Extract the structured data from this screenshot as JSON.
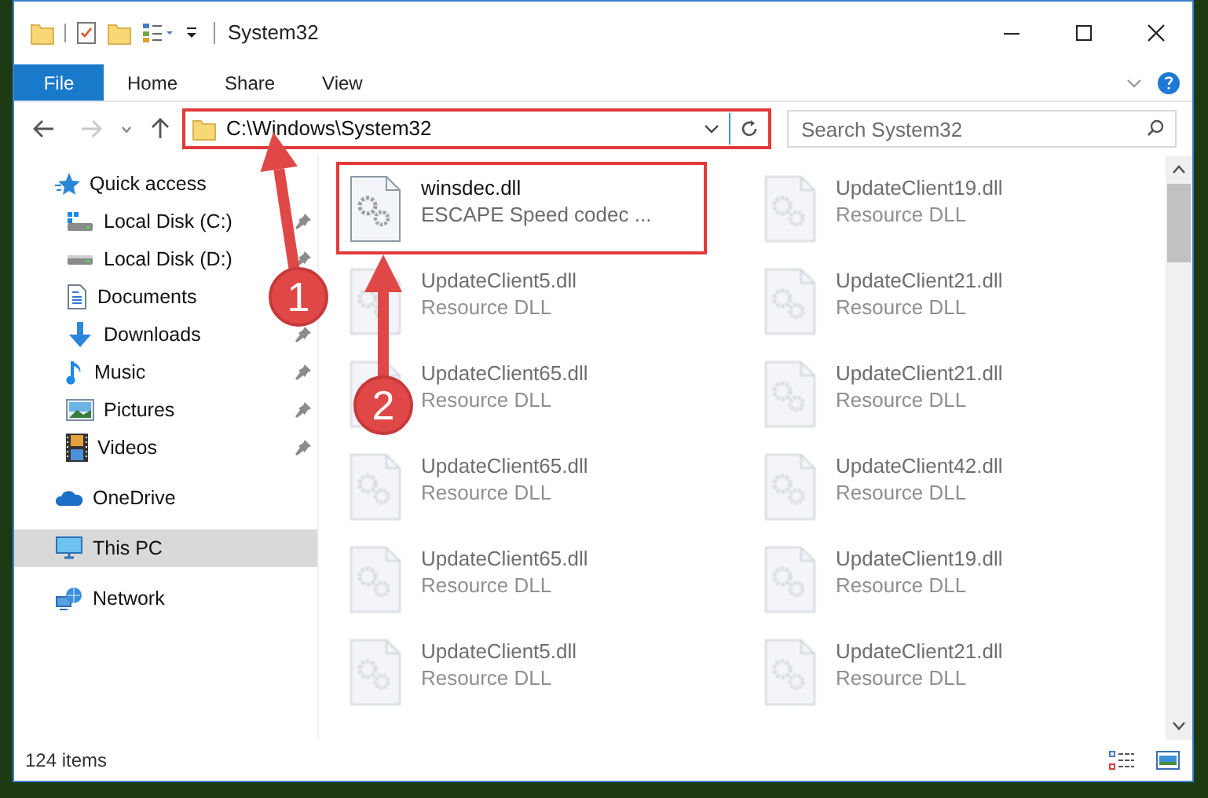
{
  "window": {
    "title": "System32"
  },
  "ribbon_tabs": [
    {
      "label": "File",
      "kind": "menu"
    },
    {
      "label": "Home",
      "kind": "tab"
    },
    {
      "label": "Share",
      "kind": "tab"
    },
    {
      "label": "View",
      "kind": "tab"
    }
  ],
  "address": {
    "path": "C:\\Windows\\System32",
    "highlighted": true
  },
  "search": {
    "placeholder": "Search System32"
  },
  "sidebar": {
    "items": [
      {
        "label": "Quick access",
        "selected": false,
        "children": [
          {
            "label": "Local Disk (C:)",
            "pinned": true,
            "selected": false
          },
          {
            "label": "Local Disk (D:)",
            "pinned": true,
            "selected": false
          },
          {
            "label": "Documents",
            "selected": false
          },
          {
            "label": "Downloads",
            "pinned": true,
            "selected": false
          },
          {
            "label": "Music",
            "pinned": true,
            "selected": false
          },
          {
            "label": "Pictures",
            "pinned": true,
            "selected": false
          },
          {
            "label": "Videos",
            "pinned": true,
            "selected": false
          }
        ]
      },
      {
        "label": "OneDrive",
        "selected": false
      },
      {
        "label": "This PC",
        "selected": true
      },
      {
        "label": "Network",
        "selected": false
      }
    ]
  },
  "files": [
    {
      "name": "winsdec.dll",
      "description": "ESCAPE Speed codec ...",
      "highlighted": true,
      "blurred": false
    },
    {
      "name": "UpdateClient19.dll",
      "description": "Resource DLL",
      "highlighted": false,
      "blurred": true
    },
    {
      "name": "UpdateClient5.dll",
      "description": "Resource DLL",
      "highlighted": false,
      "blurred": true
    },
    {
      "name": "UpdateClient21.dll",
      "description": "Resource DLL",
      "highlighted": false,
      "blurred": true
    },
    {
      "name": "UpdateClient65.dll",
      "description": "Resource DLL",
      "highlighted": false,
      "blurred": true
    },
    {
      "name": "UpdateClient21.dll",
      "description": "Resource DLL",
      "highlighted": false,
      "blurred": true
    },
    {
      "name": "UpdateClient65.dll",
      "description": "Resource DLL",
      "highlighted": false,
      "blurred": true
    },
    {
      "name": "UpdateClient42.dll",
      "description": "Resource DLL",
      "highlighted": false,
      "blurred": true
    },
    {
      "name": "UpdateClient65.dll",
      "description": "Resource DLL",
      "highlighted": false,
      "blurred": true
    },
    {
      "name": "UpdateClient19.dll",
      "description": "Resource DLL",
      "highlighted": false,
      "blurred": true
    },
    {
      "name": "UpdateClient5.dll",
      "description": "Resource DLL",
      "highlighted": false,
      "blurred": true
    },
    {
      "name": "UpdateClient21.dll",
      "description": "Resource DLL",
      "highlighted": false,
      "blurred": true
    }
  ],
  "status_bar": {
    "item_count": "124 items"
  },
  "annotations": [
    {
      "label": "1"
    },
    {
      "label": "2"
    }
  ]
}
